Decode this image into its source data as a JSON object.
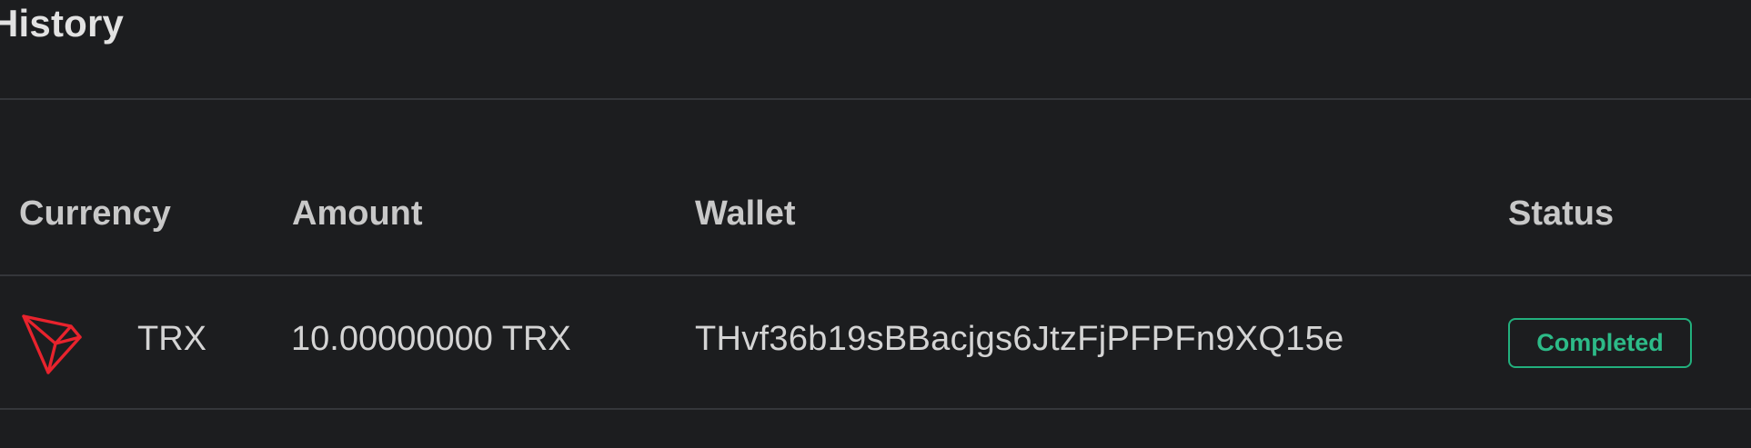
{
  "panel": {
    "title": "History"
  },
  "table": {
    "columns": [
      "Currency",
      "Amount",
      "Wallet",
      "Status"
    ],
    "rows": [
      {
        "currency_icon": "tron-icon",
        "currency": "TRX",
        "amount": "10.00000000 TRX",
        "wallet": "THvf36b19sBBacjgs6JtzFjPFPFn9XQ15e",
        "status": "Completed"
      }
    ]
  },
  "colors": {
    "background": "#1c1d1f",
    "divider": "#34363a",
    "tron_red": "#e8232d",
    "status_completed": "#2dbb88"
  }
}
